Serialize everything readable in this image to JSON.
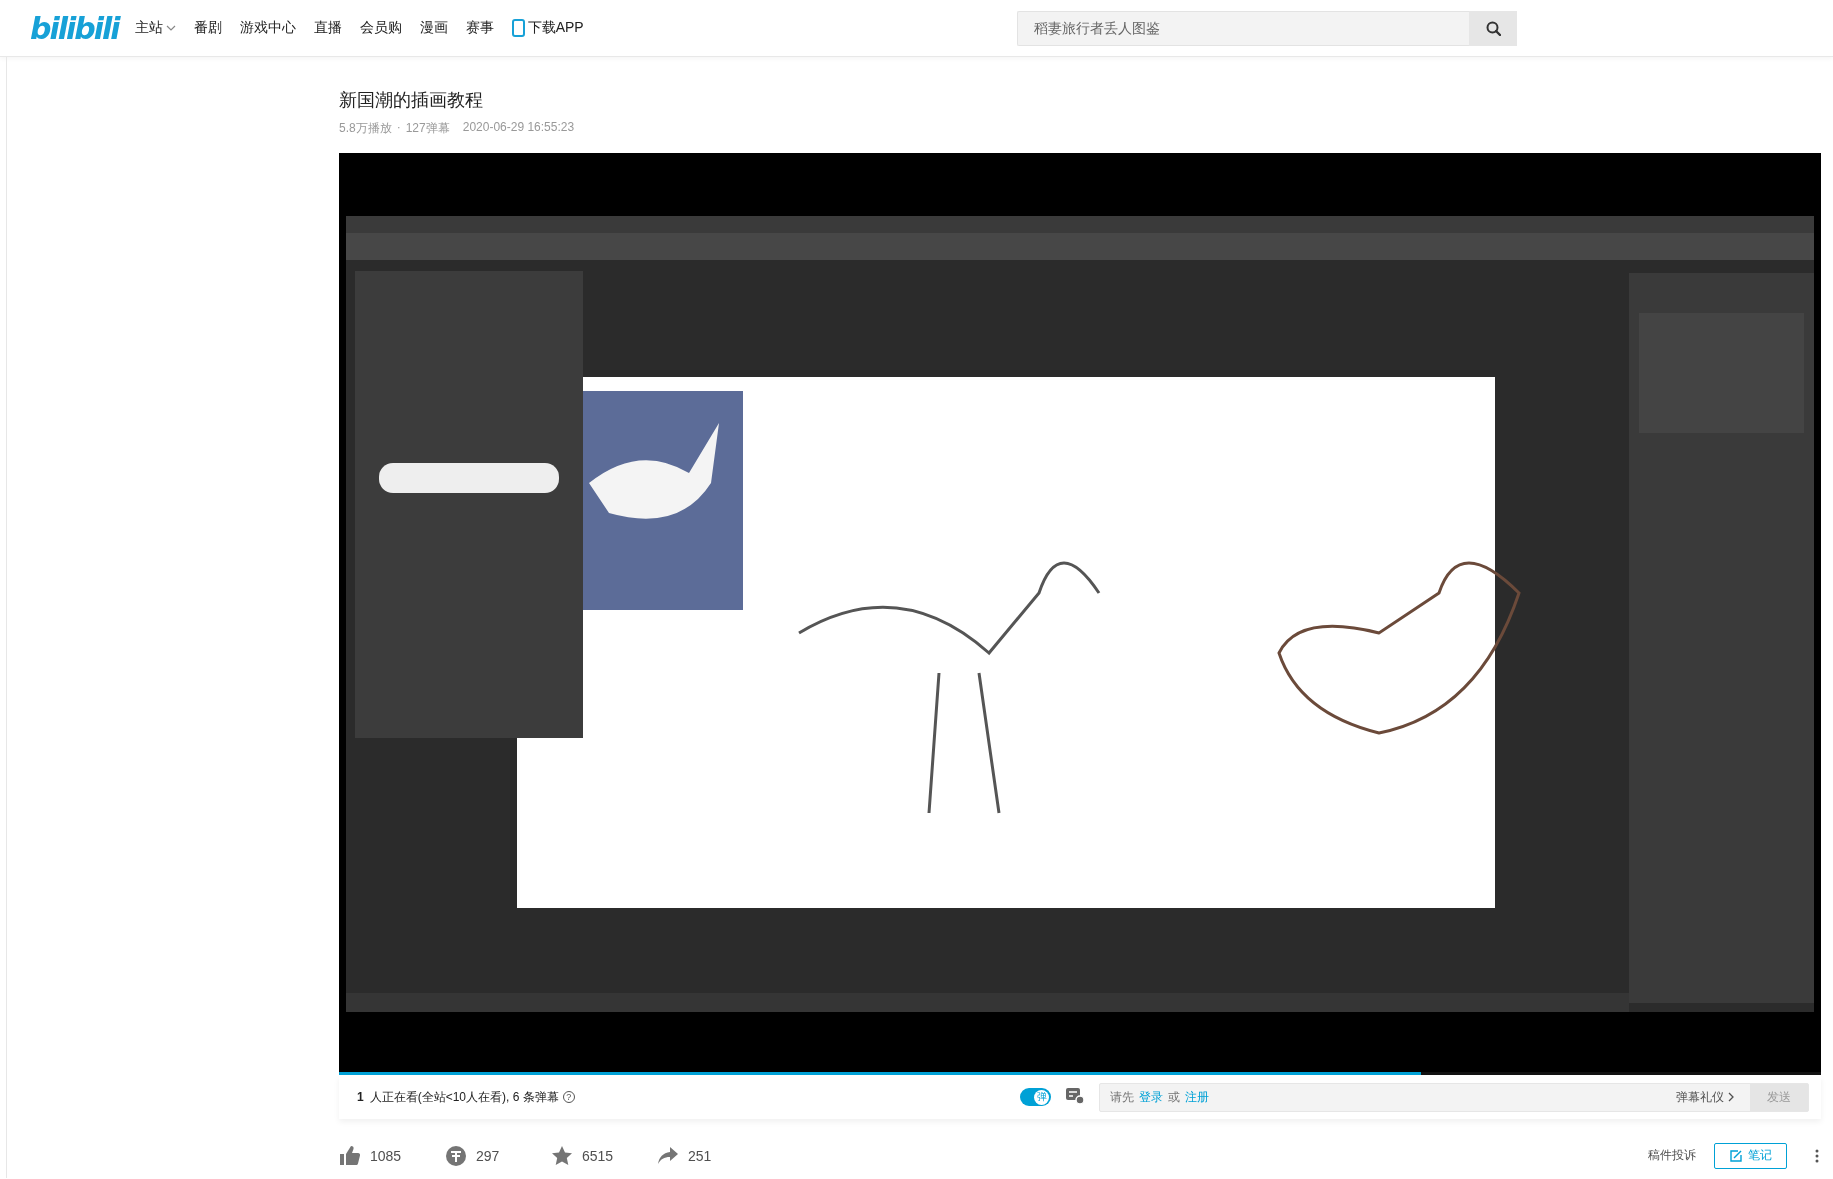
{
  "header": {
    "logo": "bilibili",
    "nav": [
      {
        "label": "主站",
        "kind": "dropdown"
      },
      {
        "label": "番剧",
        "kind": "link"
      },
      {
        "label": "游戏中心",
        "kind": "link"
      },
      {
        "label": "直播",
        "kind": "link"
      },
      {
        "label": "会员购",
        "kind": "link"
      },
      {
        "label": "漫画",
        "kind": "link"
      },
      {
        "label": "赛事",
        "kind": "link"
      },
      {
        "label": "下载APP",
        "kind": "app"
      }
    ],
    "search": {
      "placeholder": "稻妻旅行者丢人图鉴"
    }
  },
  "video": {
    "title": "新国潮的插画教程",
    "views": "5.8万播放",
    "separator": "·",
    "danmaku_count": "127弹幕",
    "date": "2020-06-29 16:55:23",
    "progress": {
      "level": 0.73
    }
  },
  "danmaku_bar": {
    "viewers_count": "1",
    "viewers_text": "人正在看(全站<10人在看), 6 条弹幕",
    "help": "?",
    "toggle": {
      "label": "弹",
      "on": true
    },
    "input": {
      "prefix": "请先",
      "login": "登录",
      "or": "或",
      "register": "注册"
    },
    "etiquette": "弹幕礼仪",
    "send": {
      "label": "发送",
      "disabled": true
    }
  },
  "actions": [
    {
      "kind": "like",
      "count": "1085"
    },
    {
      "kind": "coin",
      "count": "297"
    },
    {
      "kind": "favorite",
      "count": "6515"
    },
    {
      "kind": "share",
      "count": "251"
    }
  ],
  "report": "稿件投诉",
  "note": "笔记"
}
